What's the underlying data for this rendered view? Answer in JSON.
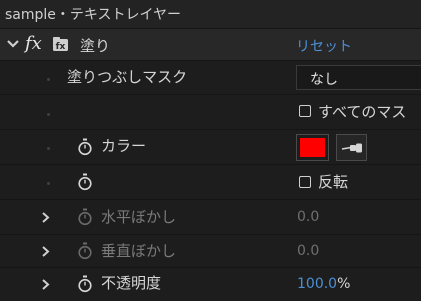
{
  "panel": {
    "title": "sample・テキストレイヤー"
  },
  "effect": {
    "fx_label": "fx",
    "name": "塗り",
    "reset_label": "リセット"
  },
  "properties": {
    "mask": {
      "label": "塗りつぶしマスク",
      "value": "なし"
    },
    "all_masks": {
      "label": "すべてのマス",
      "checked": false
    },
    "color": {
      "label": "カラー",
      "value": "#ff0000",
      "eyedropper_icon": "eyedropper-icon"
    },
    "invert": {
      "label": "反転",
      "checked": false
    },
    "h_blur": {
      "label": "水平ぼかし",
      "value": "0.0"
    },
    "v_blur": {
      "label": "垂直ぼかし",
      "value": "0.0"
    },
    "opacity": {
      "label": "不透明度",
      "value_number": "100.0",
      "value_unit": "%"
    }
  },
  "colors": {
    "link_blue": "#4d8fd6",
    "fill_red": "#ff0000"
  }
}
